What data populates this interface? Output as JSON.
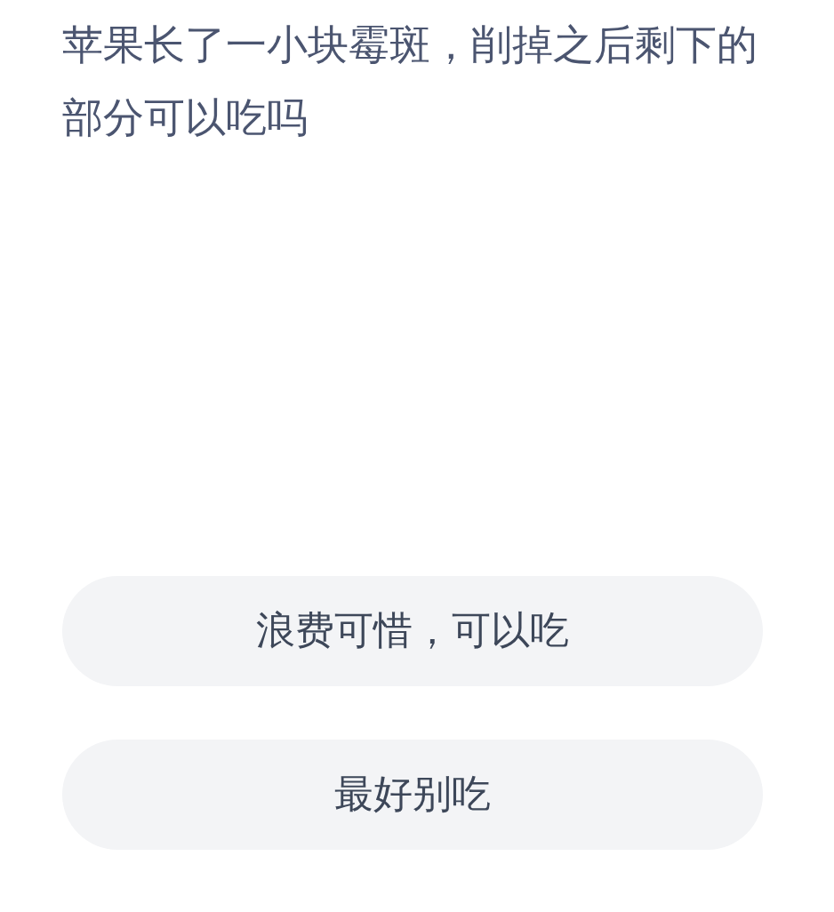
{
  "question": "苹果长了一小块霉斑，削掉之后剩下的部分可以吃吗",
  "options": [
    {
      "label": "浪费可惜，可以吃"
    },
    {
      "label": "最好别吃"
    }
  ]
}
